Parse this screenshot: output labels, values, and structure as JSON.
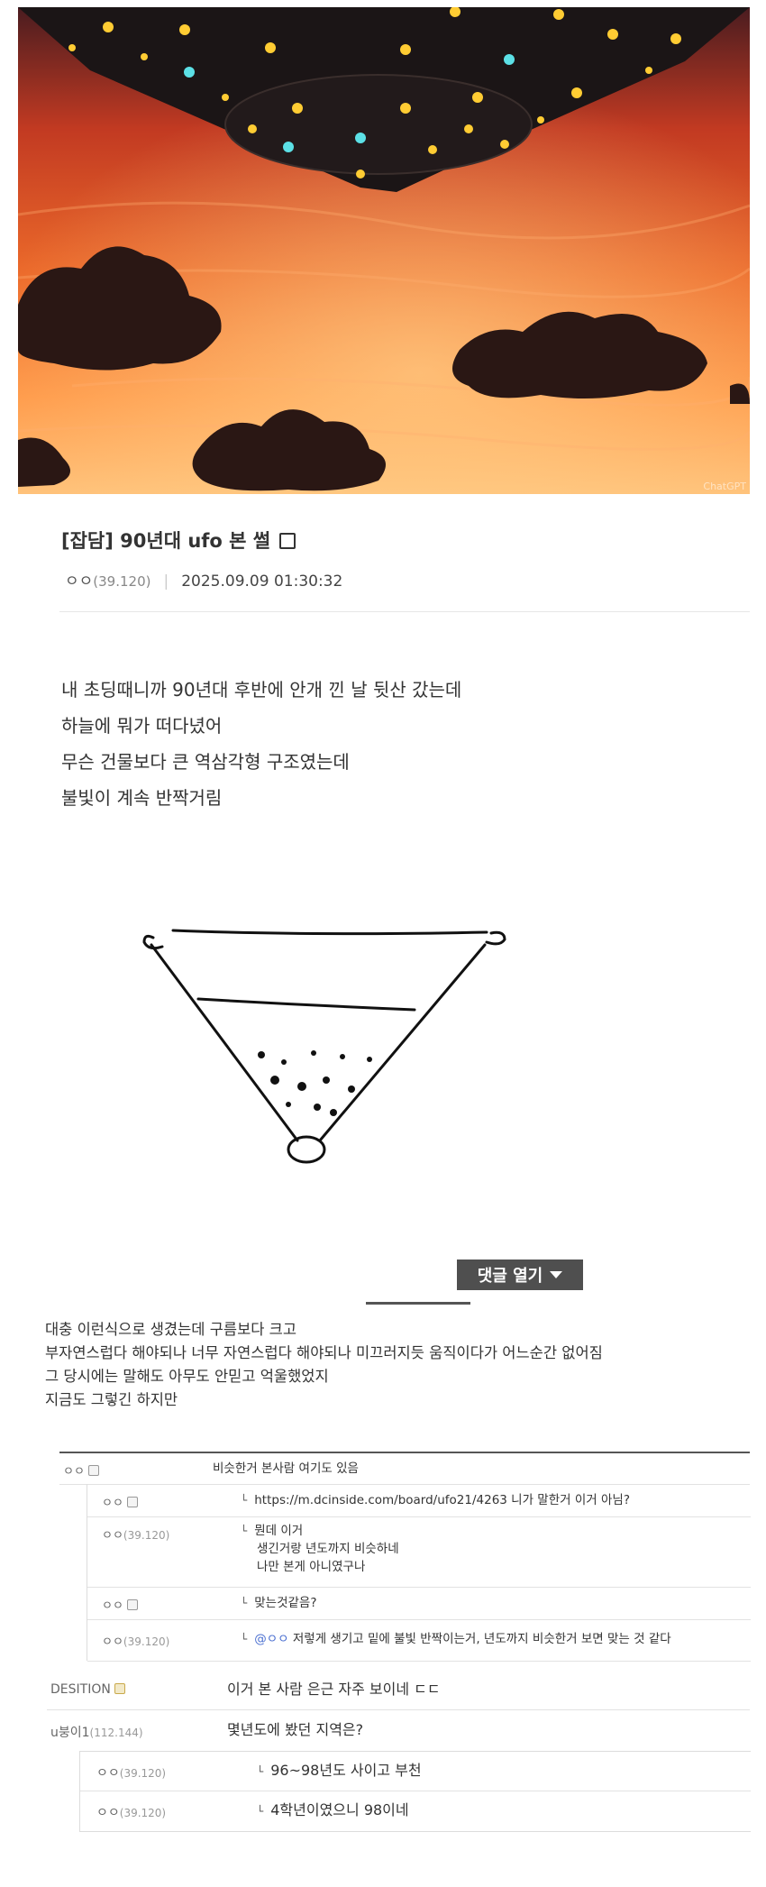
{
  "hero_image": {
    "description_icon": "ufo-over-sunset-image",
    "watermark": "ChatGPT",
    "colors": {
      "sky_top": "#3b1a1a",
      "sky_mid": "#e0522a",
      "sky_bottom": "#ffb066",
      "ufo": "#1a1414",
      "light_yellow": "#ffcc33",
      "light_cyan": "#5ce0e6"
    }
  },
  "post": {
    "title": "[잡담] 90년대 ufo 본 썰",
    "author": "ㅇㅇ",
    "author_ip": "(39.120)",
    "date": "2025.09.09 01:30:32",
    "body_lines": [
      "내 초딩때니까 90년대 후반에 안개 낀 날 뒷산 갔는데",
      "하늘에 뭐가 떠다녔어",
      "무슨 건물보다 큰 역삼각형 구조였는데",
      "불빛이 계속 반짝거림"
    ],
    "open_comments_label": "댓글 열기",
    "caption_lines": [
      "대충 이런식으로 생겼는데 구름보다 크고",
      "부자연스럽다 해야되나 너무 자연스럽다 해야되나 미끄러지듯 움직이다가 어느순간 없어짐",
      "그 당시에는 말해도 아무도 안믿고 억울했었지",
      "지금도 그렇긴 하지만"
    ]
  },
  "comments": [
    {
      "nick": "ㅇㅇ",
      "ip": "",
      "text": "비슷한거 본사람 여기도 있음"
    },
    {
      "nick": "ㅇㅇ",
      "ip": "",
      "text": "https://m.dcinside.com/board/ufo21/4263 니가 말한거 이거 아님?"
    },
    {
      "nick": "ㅇㅇ",
      "ip": "(39.120)",
      "text_lines": [
        "뭔데 이거",
        "생긴거랑 년도까지 비슷하네",
        "나만 본게 아니였구나"
      ]
    },
    {
      "nick": "ㅇㅇ",
      "ip": "",
      "text": "맞는것같음?"
    },
    {
      "nick": "ㅇㅇ",
      "ip": "(39.120)",
      "mention": "@ㅇㅇ",
      "text": "저렇게 생기고 밑에 불빛 반짝이는거, 년도까지 비슷한거 보면 맞는 것 같다"
    },
    {
      "nick": "DESITION",
      "ip": "",
      "text": "이거 본 사람 은근 자주 보이네 ㄷㄷ"
    },
    {
      "nick": "u붕이1",
      "ip": "(112.144)",
      "text": "몇년도에 봤던 지역은?"
    },
    {
      "nick": "ㅇㅇ",
      "ip": "(39.120)",
      "text": "96~98년도 사이고 부천"
    },
    {
      "nick": "ㅇㅇ",
      "ip": "(39.120)",
      "text": "4학년이였으니 98이네"
    }
  ]
}
